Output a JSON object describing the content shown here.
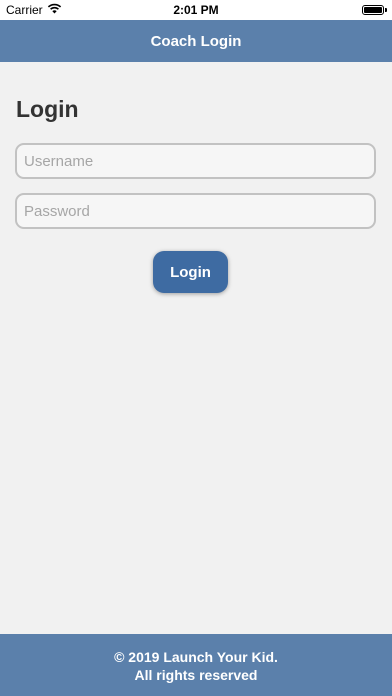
{
  "status_bar": {
    "carrier": "Carrier",
    "time": "2:01 PM",
    "wifi_icon": "wifi-icon",
    "battery_icon": "battery-icon"
  },
  "nav": {
    "title": "Coach Login"
  },
  "login": {
    "heading": "Login",
    "username_placeholder": "Username",
    "password_placeholder": "Password",
    "button_label": "Login"
  },
  "footer": {
    "line1": "© 2019 Launch Your Kid.",
    "line2": "All rights reserved"
  },
  "colors": {
    "brand_blue": "#5b80ab",
    "button_blue": "#3e6ba2",
    "background": "#f1f1f1"
  }
}
